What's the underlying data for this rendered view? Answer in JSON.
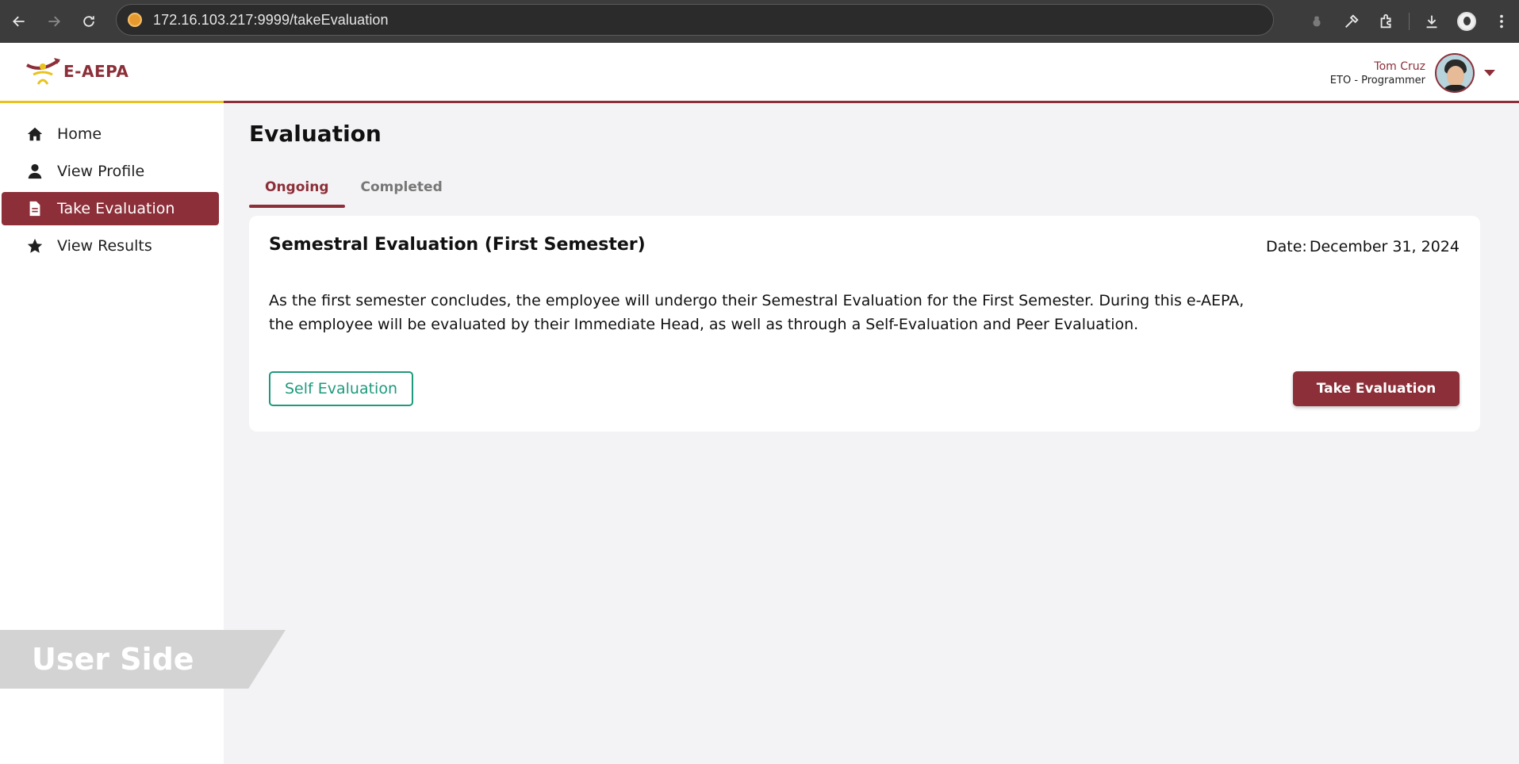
{
  "browser": {
    "url": "172.16.103.217:9999/takeEvaluation"
  },
  "header": {
    "logo_text": "E-AEPA",
    "user_name": "Tom Cruz",
    "user_role": "ETO - Programmer"
  },
  "sidebar": {
    "items": [
      {
        "label": "Home",
        "icon": "home-icon"
      },
      {
        "label": "View Profile",
        "icon": "user-icon"
      },
      {
        "label": "Take Evaluation",
        "icon": "document-icon",
        "active": true
      },
      {
        "label": "View Results",
        "icon": "star-icon"
      }
    ]
  },
  "banner": {
    "text": "User Side"
  },
  "main": {
    "title": "Evaluation",
    "tabs": [
      {
        "label": "Ongoing",
        "active": true
      },
      {
        "label": "Completed",
        "active": false
      }
    ],
    "card": {
      "title": "Semestral Evaluation (First Semester)",
      "date_label": "Date:",
      "date_value": "December 31, 2024",
      "description": "As the first semester concludes, the employee will undergo their Semestral Evaluation for the First Semester. During this e-AEPA, the employee will be evaluated by their Immediate Head, as well as through a Self-Evaluation and Peer Evaluation.",
      "self_eval_label": "Self Evaluation",
      "take_eval_label": "Take Evaluation"
    }
  },
  "colors": {
    "brand": "#8c2f39",
    "accent_yellow": "#e8c31f",
    "self_eval_green": "#1e9a7c"
  }
}
